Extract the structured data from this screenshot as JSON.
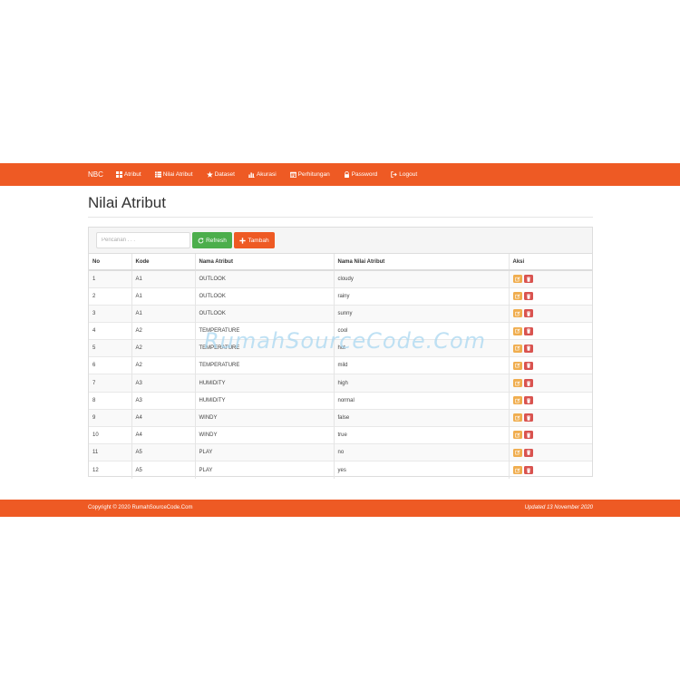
{
  "navbar": {
    "brand": "NBC",
    "items": [
      {
        "label": "Atribut",
        "icon": "grid-icon"
      },
      {
        "label": "Nilai Atribut",
        "icon": "list-icon"
      },
      {
        "label": "Dataset",
        "icon": "star-icon"
      },
      {
        "label": "Akurasi",
        "icon": "bar-chart-icon"
      },
      {
        "label": "Perhitungan",
        "icon": "calendar-icon"
      },
      {
        "label": "Password",
        "icon": "lock-icon"
      },
      {
        "label": "Logout",
        "icon": "logout-icon"
      }
    ]
  },
  "page": {
    "title": "Nilai Atribut"
  },
  "toolbar": {
    "search_placeholder": "Pencarian . . .",
    "refresh_label": "Refresh",
    "add_label": "Tambah"
  },
  "table": {
    "headers": [
      "No",
      "Kode",
      "Nama Atribut",
      "Nama Nilai Atribut",
      "Aksi"
    ],
    "rows": [
      [
        "1",
        "A1",
        "OUTLOOK",
        "cloudy"
      ],
      [
        "2",
        "A1",
        "OUTLOOK",
        "rainy"
      ],
      [
        "3",
        "A1",
        "OUTLOOK",
        "sunny"
      ],
      [
        "4",
        "A2",
        "TEMPERATURE",
        "cool"
      ],
      [
        "5",
        "A2",
        "TEMPERATURE",
        "hot"
      ],
      [
        "6",
        "A2",
        "TEMPERATURE",
        "mild"
      ],
      [
        "7",
        "A3",
        "HUMIDITY",
        "high"
      ],
      [
        "8",
        "A3",
        "HUMIDITY",
        "normal"
      ],
      [
        "9",
        "A4",
        "WINDY",
        "false"
      ],
      [
        "10",
        "A4",
        "WINDY",
        "true"
      ],
      [
        "11",
        "A5",
        "PLAY",
        "no"
      ],
      [
        "12",
        "A5",
        "PLAY",
        "yes"
      ]
    ]
  },
  "watermark": "RumahSourceCode.Com",
  "footer": {
    "copyright": "Copyright © 2020 RumahSourceCode.Com",
    "updated": "Updated 13 November 2020"
  },
  "colors": {
    "brand": "#ee5a24",
    "success": "#4cae4c",
    "warning": "#f0ad4e",
    "danger": "#d9534f"
  }
}
